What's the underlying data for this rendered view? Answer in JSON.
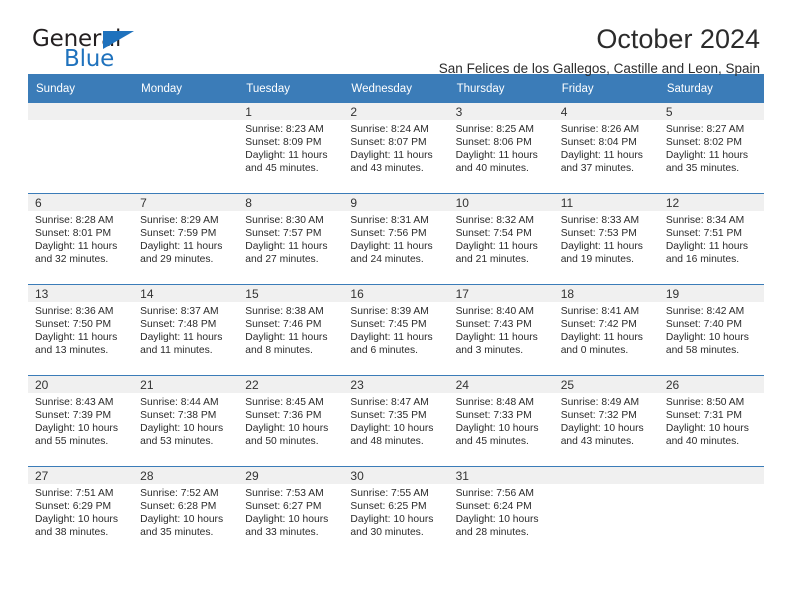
{
  "brand": {
    "name_part1": "General",
    "name_part2": "Blue",
    "triangle_icon": "triangle-icon",
    "color_blue": "#1f72bd",
    "color_dark": "#231f20"
  },
  "header": {
    "title": "October 2024",
    "subtitle": "San Felices de los Gallegos, Castille and Leon, Spain"
  },
  "theme": {
    "header_bg": "#3b7cb8",
    "header_text": "#ffffff",
    "daynum_strip": "#f0f0f0",
    "cell_bg": "#ffffff",
    "row_divider": "#3b7cb8"
  },
  "weekdays": [
    "Sunday",
    "Monday",
    "Tuesday",
    "Wednesday",
    "Thursday",
    "Friday",
    "Saturday"
  ],
  "weeks": [
    [
      {
        "day": "",
        "empty": true
      },
      {
        "day": "",
        "empty": true
      },
      {
        "day": "1",
        "sunrise": "Sunrise: 8:23 AM",
        "sunset": "Sunset: 8:09 PM",
        "daylight1": "Daylight: 11 hours",
        "daylight2": "and 45 minutes."
      },
      {
        "day": "2",
        "sunrise": "Sunrise: 8:24 AM",
        "sunset": "Sunset: 8:07 PM",
        "daylight1": "Daylight: 11 hours",
        "daylight2": "and 43 minutes."
      },
      {
        "day": "3",
        "sunrise": "Sunrise: 8:25 AM",
        "sunset": "Sunset: 8:06 PM",
        "daylight1": "Daylight: 11 hours",
        "daylight2": "and 40 minutes."
      },
      {
        "day": "4",
        "sunrise": "Sunrise: 8:26 AM",
        "sunset": "Sunset: 8:04 PM",
        "daylight1": "Daylight: 11 hours",
        "daylight2": "and 37 minutes."
      },
      {
        "day": "5",
        "sunrise": "Sunrise: 8:27 AM",
        "sunset": "Sunset: 8:02 PM",
        "daylight1": "Daylight: 11 hours",
        "daylight2": "and 35 minutes."
      }
    ],
    [
      {
        "day": "6",
        "sunrise": "Sunrise: 8:28 AM",
        "sunset": "Sunset: 8:01 PM",
        "daylight1": "Daylight: 11 hours",
        "daylight2": "and 32 minutes."
      },
      {
        "day": "7",
        "sunrise": "Sunrise: 8:29 AM",
        "sunset": "Sunset: 7:59 PM",
        "daylight1": "Daylight: 11 hours",
        "daylight2": "and 29 minutes."
      },
      {
        "day": "8",
        "sunrise": "Sunrise: 8:30 AM",
        "sunset": "Sunset: 7:57 PM",
        "daylight1": "Daylight: 11 hours",
        "daylight2": "and 27 minutes."
      },
      {
        "day": "9",
        "sunrise": "Sunrise: 8:31 AM",
        "sunset": "Sunset: 7:56 PM",
        "daylight1": "Daylight: 11 hours",
        "daylight2": "and 24 minutes."
      },
      {
        "day": "10",
        "sunrise": "Sunrise: 8:32 AM",
        "sunset": "Sunset: 7:54 PM",
        "daylight1": "Daylight: 11 hours",
        "daylight2": "and 21 minutes."
      },
      {
        "day": "11",
        "sunrise": "Sunrise: 8:33 AM",
        "sunset": "Sunset: 7:53 PM",
        "daylight1": "Daylight: 11 hours",
        "daylight2": "and 19 minutes."
      },
      {
        "day": "12",
        "sunrise": "Sunrise: 8:34 AM",
        "sunset": "Sunset: 7:51 PM",
        "daylight1": "Daylight: 11 hours",
        "daylight2": "and 16 minutes."
      }
    ],
    [
      {
        "day": "13",
        "sunrise": "Sunrise: 8:36 AM",
        "sunset": "Sunset: 7:50 PM",
        "daylight1": "Daylight: 11 hours",
        "daylight2": "and 13 minutes."
      },
      {
        "day": "14",
        "sunrise": "Sunrise: 8:37 AM",
        "sunset": "Sunset: 7:48 PM",
        "daylight1": "Daylight: 11 hours",
        "daylight2": "and 11 minutes."
      },
      {
        "day": "15",
        "sunrise": "Sunrise: 8:38 AM",
        "sunset": "Sunset: 7:46 PM",
        "daylight1": "Daylight: 11 hours",
        "daylight2": "and 8 minutes."
      },
      {
        "day": "16",
        "sunrise": "Sunrise: 8:39 AM",
        "sunset": "Sunset: 7:45 PM",
        "daylight1": "Daylight: 11 hours",
        "daylight2": "and 6 minutes."
      },
      {
        "day": "17",
        "sunrise": "Sunrise: 8:40 AM",
        "sunset": "Sunset: 7:43 PM",
        "daylight1": "Daylight: 11 hours",
        "daylight2": "and 3 minutes."
      },
      {
        "day": "18",
        "sunrise": "Sunrise: 8:41 AM",
        "sunset": "Sunset: 7:42 PM",
        "daylight1": "Daylight: 11 hours",
        "daylight2": "and 0 minutes."
      },
      {
        "day": "19",
        "sunrise": "Sunrise: 8:42 AM",
        "sunset": "Sunset: 7:40 PM",
        "daylight1": "Daylight: 10 hours",
        "daylight2": "and 58 minutes."
      }
    ],
    [
      {
        "day": "20",
        "sunrise": "Sunrise: 8:43 AM",
        "sunset": "Sunset: 7:39 PM",
        "daylight1": "Daylight: 10 hours",
        "daylight2": "and 55 minutes."
      },
      {
        "day": "21",
        "sunrise": "Sunrise: 8:44 AM",
        "sunset": "Sunset: 7:38 PM",
        "daylight1": "Daylight: 10 hours",
        "daylight2": "and 53 minutes."
      },
      {
        "day": "22",
        "sunrise": "Sunrise: 8:45 AM",
        "sunset": "Sunset: 7:36 PM",
        "daylight1": "Daylight: 10 hours",
        "daylight2": "and 50 minutes."
      },
      {
        "day": "23",
        "sunrise": "Sunrise: 8:47 AM",
        "sunset": "Sunset: 7:35 PM",
        "daylight1": "Daylight: 10 hours",
        "daylight2": "and 48 minutes."
      },
      {
        "day": "24",
        "sunrise": "Sunrise: 8:48 AM",
        "sunset": "Sunset: 7:33 PM",
        "daylight1": "Daylight: 10 hours",
        "daylight2": "and 45 minutes."
      },
      {
        "day": "25",
        "sunrise": "Sunrise: 8:49 AM",
        "sunset": "Sunset: 7:32 PM",
        "daylight1": "Daylight: 10 hours",
        "daylight2": "and 43 minutes."
      },
      {
        "day": "26",
        "sunrise": "Sunrise: 8:50 AM",
        "sunset": "Sunset: 7:31 PM",
        "daylight1": "Daylight: 10 hours",
        "daylight2": "and 40 minutes."
      }
    ],
    [
      {
        "day": "27",
        "sunrise": "Sunrise: 7:51 AM",
        "sunset": "Sunset: 6:29 PM",
        "daylight1": "Daylight: 10 hours",
        "daylight2": "and 38 minutes."
      },
      {
        "day": "28",
        "sunrise": "Sunrise: 7:52 AM",
        "sunset": "Sunset: 6:28 PM",
        "daylight1": "Daylight: 10 hours",
        "daylight2": "and 35 minutes."
      },
      {
        "day": "29",
        "sunrise": "Sunrise: 7:53 AM",
        "sunset": "Sunset: 6:27 PM",
        "daylight1": "Daylight: 10 hours",
        "daylight2": "and 33 minutes."
      },
      {
        "day": "30",
        "sunrise": "Sunrise: 7:55 AM",
        "sunset": "Sunset: 6:25 PM",
        "daylight1": "Daylight: 10 hours",
        "daylight2": "and 30 minutes."
      },
      {
        "day": "31",
        "sunrise": "Sunrise: 7:56 AM",
        "sunset": "Sunset: 6:24 PM",
        "daylight1": "Daylight: 10 hours",
        "daylight2": "and 28 minutes."
      },
      {
        "day": "",
        "empty": true
      },
      {
        "day": "",
        "empty": true
      }
    ]
  ]
}
